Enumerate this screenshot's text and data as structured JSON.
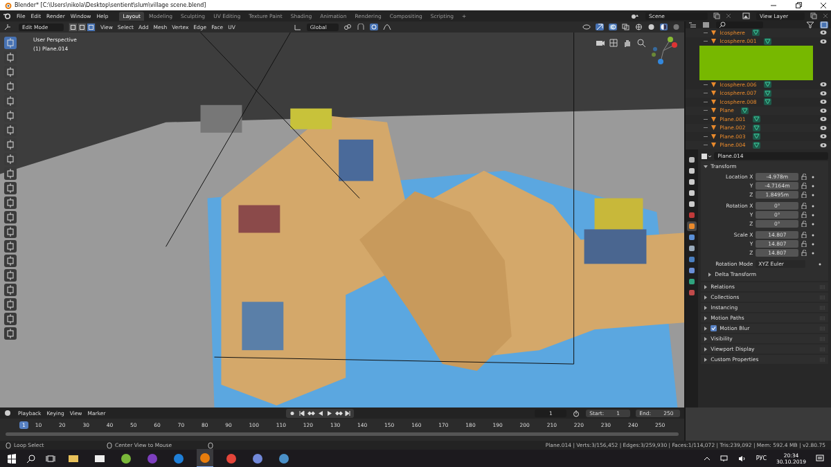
{
  "title": "Blender* [C:\\Users\\nikola\\Desktop\\sentient\\slum\\village scene.blend]",
  "menu": [
    "File",
    "Edit",
    "Render",
    "Window",
    "Help"
  ],
  "workspaces": [
    {
      "label": "Layout",
      "selected": true
    },
    {
      "label": "Modeling",
      "selected": false
    },
    {
      "label": "Sculpting",
      "selected": false
    },
    {
      "label": "UV Editing",
      "selected": false
    },
    {
      "label": "Texture Paint",
      "selected": false
    },
    {
      "label": "Shading",
      "selected": false
    },
    {
      "label": "Animation",
      "selected": false
    },
    {
      "label": "Rendering",
      "selected": false
    },
    {
      "label": "Compositing",
      "selected": false
    },
    {
      "label": "Scripting",
      "selected": false
    }
  ],
  "add_workspace": "+",
  "scene": "Scene",
  "view_layer": "View Layer",
  "viewport": {
    "mode": "Edit Mode",
    "select_modes": [
      {
        "selected": false
      },
      {
        "selected": false
      },
      {
        "selected": true
      }
    ],
    "menus": [
      "View",
      "Select",
      "Add",
      "Mesh",
      "Vertex",
      "Edge",
      "Face",
      "UV"
    ],
    "orientation": "Global",
    "overlay_text": [
      "User Perspective",
      "(1) Plane.014"
    ],
    "tools": [
      {
        "selected": true
      },
      {
        "selected": false
      },
      {
        "selected": false
      },
      {
        "selected": false
      },
      {
        "selected": false
      },
      {
        "selected": false
      },
      {
        "selected": false
      },
      {
        "selected": false
      },
      {
        "selected": false
      },
      {
        "selected": false
      },
      {
        "selected": false
      },
      {
        "selected": false
      },
      {
        "selected": false
      },
      {
        "selected": false
      },
      {
        "selected": false
      },
      {
        "selected": false
      },
      {
        "selected": false
      },
      {
        "selected": false
      },
      {
        "selected": false
      },
      {
        "selected": false
      },
      {
        "selected": false
      }
    ]
  },
  "outliner": {
    "items_above": [
      "Icosphere",
      "Icosphere.001"
    ],
    "items_below": [
      "Icosphere.006",
      "Icosphere.007",
      "Icosphere.008",
      "Plane",
      "Plane.001",
      "Plane.002",
      "Plane.003",
      "Plane.004"
    ]
  },
  "properties": {
    "tabs": [
      {
        "kind": "tool",
        "selected": false
      },
      {
        "kind": "render",
        "selected": false
      },
      {
        "kind": "output",
        "selected": false
      },
      {
        "kind": "view_layer",
        "selected": false
      },
      {
        "kind": "scene",
        "selected": false
      },
      {
        "kind": "world",
        "selected": false
      },
      {
        "kind": "object",
        "selected": true
      },
      {
        "kind": "modifier",
        "selected": false
      },
      {
        "kind": "particles",
        "selected": false
      },
      {
        "kind": "physics",
        "selected": false
      },
      {
        "kind": "constraints",
        "selected": false
      },
      {
        "kind": "data",
        "selected": false
      },
      {
        "kind": "material",
        "selected": false
      }
    ],
    "object_name": "Plane.014",
    "transform": {
      "title": "Transform",
      "expanded": true,
      "rows": [
        {
          "label": "Location X",
          "value": "-4.978m"
        },
        {
          "label": "Y",
          "value": "-4.7164m"
        },
        {
          "label": "Z",
          "value": "1.8495m"
        },
        {
          "label": "Rotation X",
          "value": "0°"
        },
        {
          "label": "Y",
          "value": "0°"
        },
        {
          "label": "Z",
          "value": "0°"
        },
        {
          "label": "Scale X",
          "value": "14.807"
        },
        {
          "label": "Y",
          "value": "14.807"
        },
        {
          "label": "Z",
          "value": "14.807"
        }
      ],
      "rotation_mode_label": "Rotation Mode",
      "rotation_mode": "XYZ Euler",
      "subpanel": {
        "title": "Delta Transform",
        "expanded": false
      }
    },
    "panels": [
      {
        "kind": "plain",
        "title": "Relations",
        "expanded": false
      },
      {
        "kind": "plain",
        "title": "Collections",
        "expanded": false
      },
      {
        "kind": "plain",
        "title": "Instancing",
        "expanded": false
      },
      {
        "kind": "plain",
        "title": "Motion Paths",
        "expanded": false
      },
      {
        "kind": "checkbox",
        "title": "Motion Blur",
        "expanded": false,
        "checked": true
      },
      {
        "kind": "plain",
        "title": "Visibility",
        "expanded": false
      },
      {
        "kind": "plain",
        "title": "Viewport Display",
        "expanded": false
      },
      {
        "kind": "plain",
        "title": "Custom Properties",
        "expanded": false
      }
    ]
  },
  "timeline": {
    "menus": [
      "Playback",
      "Keying",
      "View",
      "Marker"
    ],
    "current_frame": "1",
    "frame_field": "1",
    "start_label": "Start:",
    "start": "1",
    "end_label": "End:",
    "end": "250",
    "ticks": [
      "10",
      "20",
      "30",
      "40",
      "50",
      "60",
      "70",
      "80",
      "90",
      "100",
      "110",
      "120",
      "130",
      "140",
      "150",
      "160",
      "170",
      "180",
      "190",
      "200",
      "210",
      "220",
      "230",
      "240",
      "250"
    ]
  },
  "status": {
    "hints": [
      "Loop Select",
      "Center View to Mouse"
    ],
    "stats": "Plane.014 | Verts:3/156,452 | Edges:3/259,930 | Faces:1/114,072 | Tris:239,092 | Mem: 592.4 MB | v2.80.75"
  },
  "taskbar": {
    "apps": [
      {
        "kind": "folder",
        "selected": false
      },
      {
        "kind": "mail",
        "selected": false
      },
      {
        "kind": "torrent",
        "selected": false
      },
      {
        "kind": "orbit",
        "selected": false
      },
      {
        "kind": "browser_e",
        "selected": false
      },
      {
        "kind": "blender",
        "selected": true
      },
      {
        "kind": "chrome",
        "selected": false
      },
      {
        "kind": "chat",
        "selected": false
      },
      {
        "kind": "shield",
        "selected": false
      }
    ],
    "lang": "РУС",
    "time": "20:34",
    "date": "30.10.2019"
  }
}
